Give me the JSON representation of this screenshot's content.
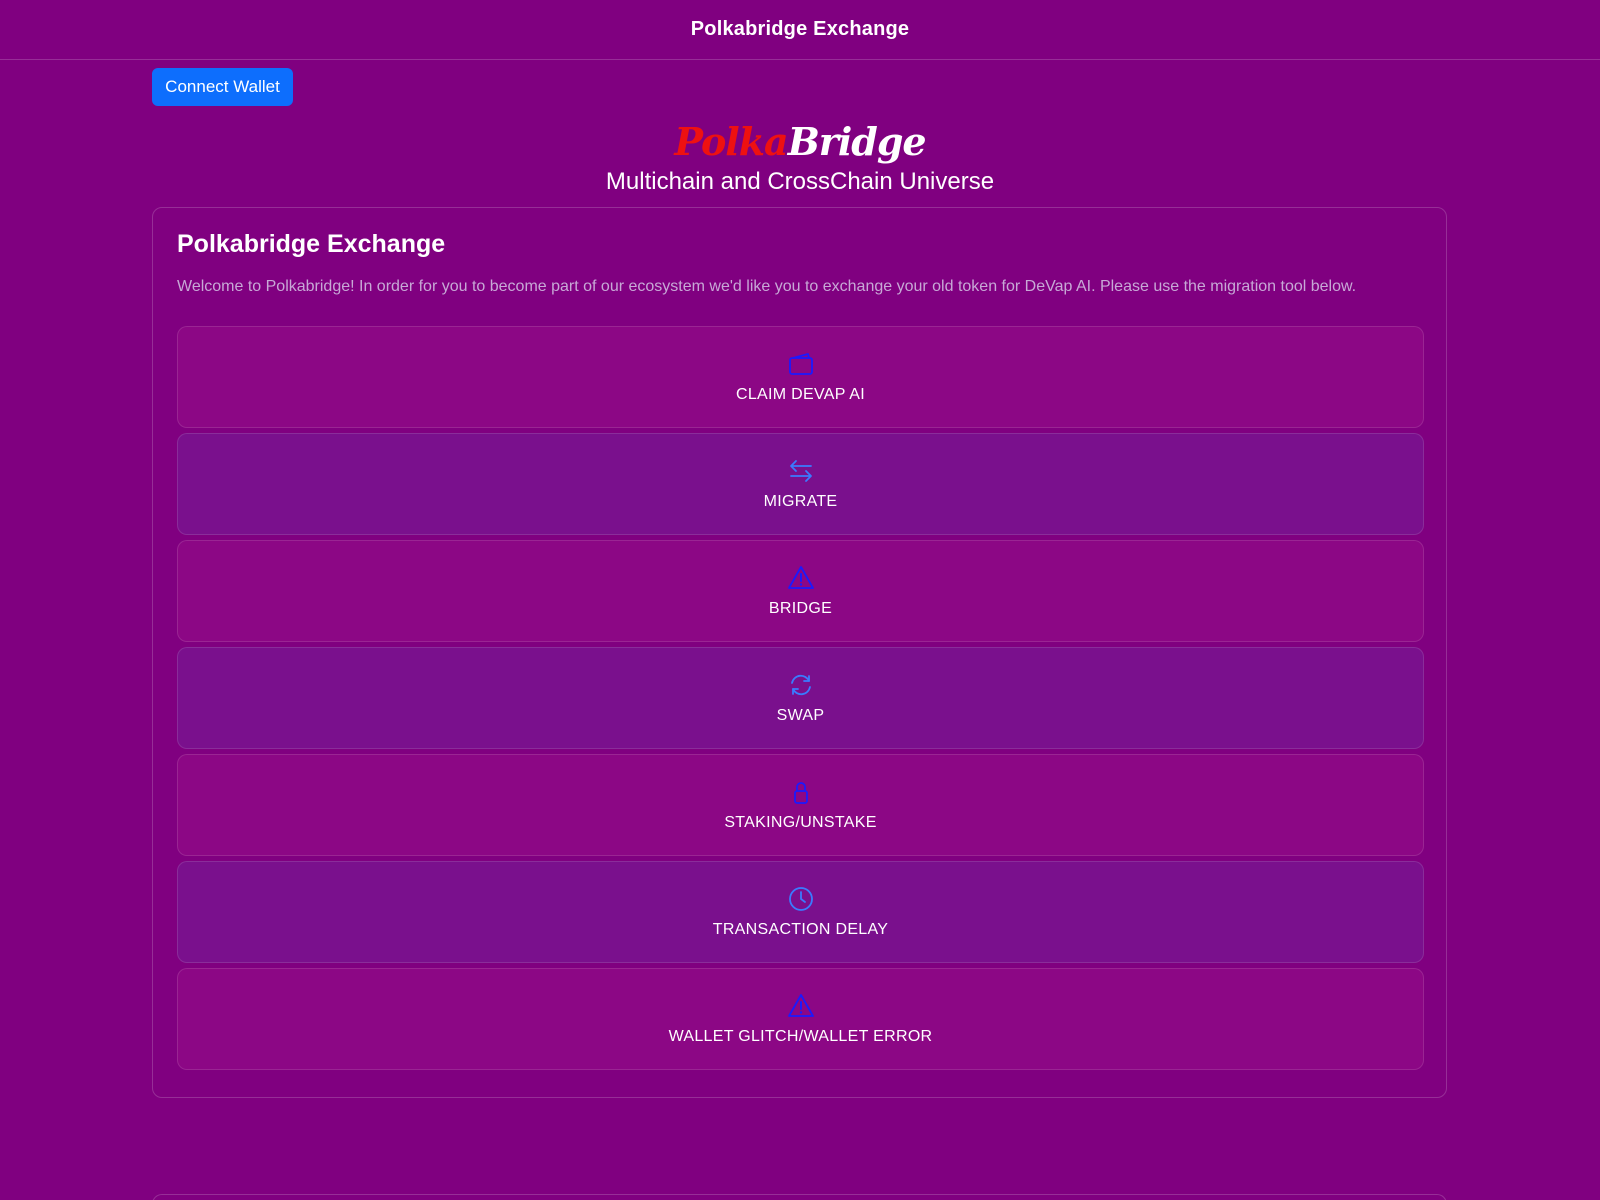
{
  "header": {
    "title": "Polkabridge Exchange"
  },
  "wallet": {
    "connect_label": "Connect Wallet"
  },
  "brand": {
    "logo_part1": "Polka",
    "logo_part2": "Bridge",
    "tagline": "Multichain and CrossChain Universe"
  },
  "card": {
    "title": "Polkabridge Exchange",
    "description": "Welcome to Polkabridge! In order for you to become part of our ecosystem we'd like you to exchange your old token for DeVap AI. Please use the migration tool below."
  },
  "options": [
    {
      "label": "CLAIM DEVAP AI",
      "icon": "wallet-icon"
    },
    {
      "label": "MIGRATE",
      "icon": "arrows-exchange-icon"
    },
    {
      "label": "BRIDGE",
      "icon": "warning-icon"
    },
    {
      "label": "SWAP",
      "icon": "refresh-icon"
    },
    {
      "label": "STAKING/UNSTAKE",
      "icon": "lock-icon"
    },
    {
      "label": "TRANSACTION DELAY",
      "icon": "clock-icon"
    },
    {
      "label": "WALLET GLITCH/WALLET ERROR",
      "icon": "warning-icon"
    }
  ],
  "colors": {
    "background": "#800080",
    "primary_button": "#0d6efd",
    "logo_red": "#ee1111",
    "option_pink": "#8c0785",
    "option_violet": "#7a108d",
    "icon_blue": "#1a1aff",
    "icon_light_blue": "#3a7bff"
  }
}
